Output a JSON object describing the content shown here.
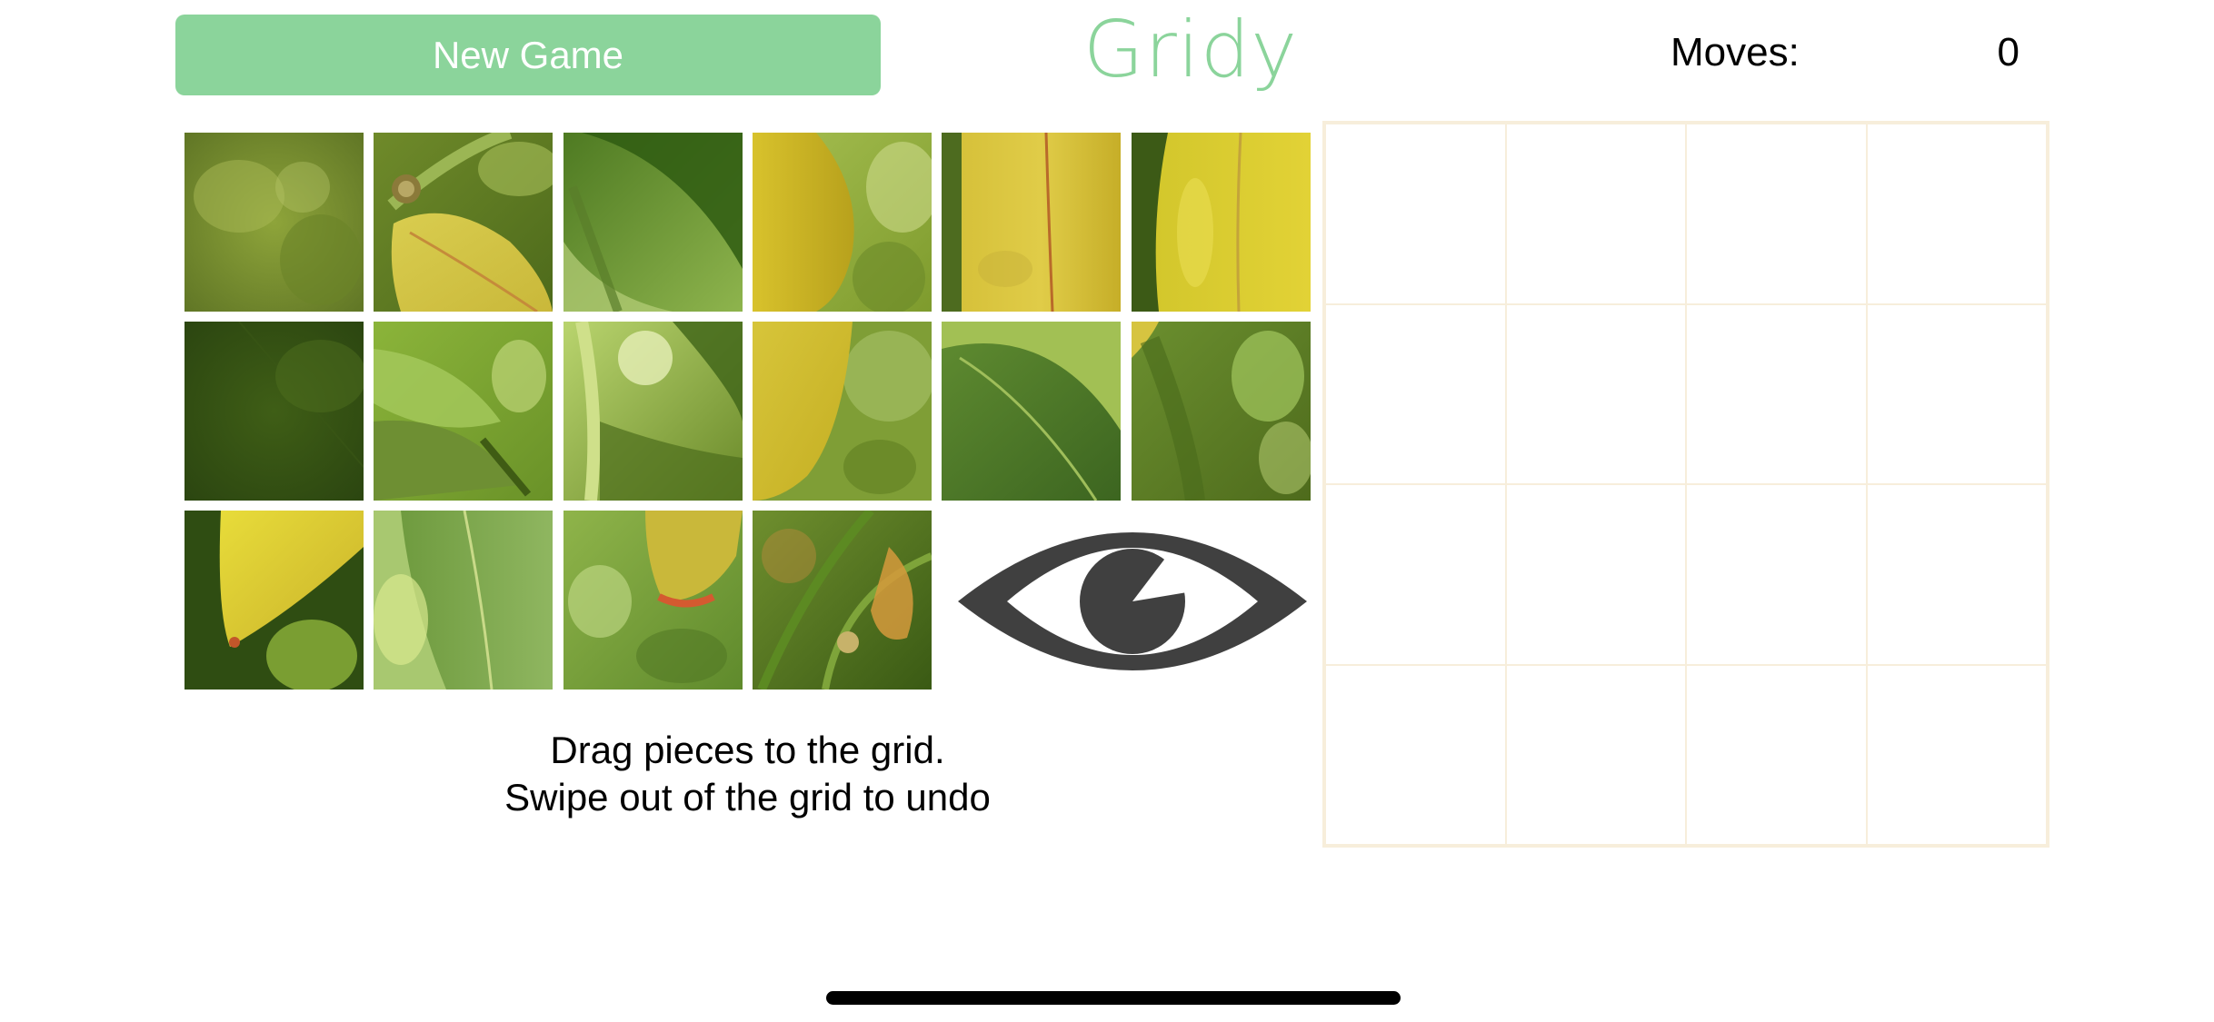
{
  "header": {
    "new_game_label": "New Game",
    "logo_text": "Gridy",
    "moves_label": "Moves:",
    "moves_value": "0"
  },
  "colors": {
    "accent": "#8bd49b",
    "grid_line": "#f7eedb",
    "eye": "#404040",
    "text": "#000000"
  },
  "pieces": [
    {
      "name": "piece-1",
      "theme": "green-blur"
    },
    {
      "name": "piece-2",
      "theme": "stem-bud-leaf"
    },
    {
      "name": "piece-3",
      "theme": "dark-leaf"
    },
    {
      "name": "piece-4",
      "theme": "yellow-leaf-left"
    },
    {
      "name": "piece-5",
      "theme": "yellow-leaf-vein"
    },
    {
      "name": "piece-6",
      "theme": "yellow-leaf-right"
    },
    {
      "name": "piece-7",
      "theme": "dark-green"
    },
    {
      "name": "piece-8",
      "theme": "green-leaves"
    },
    {
      "name": "piece-9",
      "theme": "light-stem"
    },
    {
      "name": "piece-10",
      "theme": "yellow-leaf-tip"
    },
    {
      "name": "piece-11",
      "theme": "green-leaf-vein"
    },
    {
      "name": "piece-12",
      "theme": "green-soft"
    },
    {
      "name": "piece-13",
      "theme": "yellow-corner"
    },
    {
      "name": "piece-14",
      "theme": "leaf-vein-green"
    },
    {
      "name": "piece-15",
      "theme": "leaf-orange-tip"
    },
    {
      "name": "piece-16",
      "theme": "stems-orange"
    }
  ],
  "eye_icon": "eye-icon",
  "instructions": {
    "line1": "Drag pieces to the grid.",
    "line2": "Swipe out of the grid to undo"
  }
}
